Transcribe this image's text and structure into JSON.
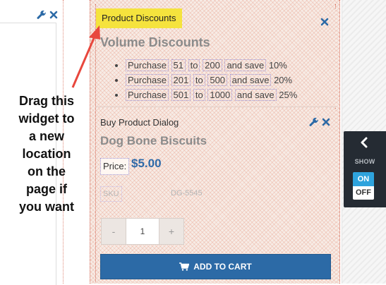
{
  "product_discounts_widget": {
    "tag": "Product Discounts",
    "title": "Volume Discounts",
    "tiers": [
      {
        "prefix": "Purchase",
        "from": "51",
        "to_word": "to",
        "to": "200",
        "save_word": "and save",
        "pct": "10%"
      },
      {
        "prefix": "Purchase",
        "from": "201",
        "to_word": "to",
        "to": "500",
        "save_word": "and save",
        "pct": "20%"
      },
      {
        "prefix": "Purchase",
        "from": "501",
        "to_word": "to",
        "to": "1000",
        "save_word": "and save",
        "pct": "25%"
      }
    ]
  },
  "buy_product_widget": {
    "label": "Buy Product Dialog",
    "title": "Dog Bone Biscuits",
    "price_label": "Price:",
    "price": "$5.00",
    "sku_label": "SKU",
    "sku": "DG-5545",
    "minus": "-",
    "quantity": "1",
    "plus": "+",
    "add_to_cart": "ADD TO CART"
  },
  "annotation": {
    "lines": [
      "Drag this",
      "widget to",
      "a new",
      "location",
      "on the",
      "page if",
      "you want"
    ],
    "arrow_color": "#e8473d"
  },
  "side_panel": {
    "show_label": "SHOW",
    "on_label": "ON",
    "off_label": "OFF"
  },
  "colors": {
    "tag_yellow": "#f5e33d",
    "accent_blue": "#2c6aa6",
    "toggle_on": "#2ea3dd"
  },
  "icons": [
    "wrench-icon",
    "close-icon",
    "chevron-left-icon",
    "shopping-cart-icon"
  ]
}
